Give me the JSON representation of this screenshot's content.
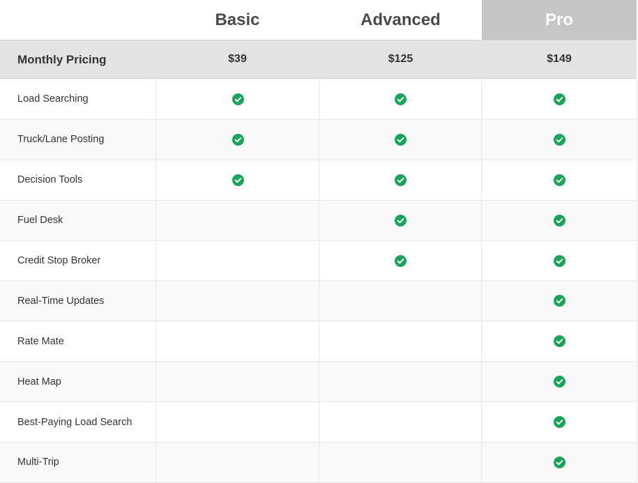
{
  "tiers": [
    "Basic",
    "Advanced",
    "Pro"
  ],
  "pricing": {
    "label": "Monthly Pricing",
    "prices": [
      "$39",
      "$125",
      "$149"
    ]
  },
  "features": [
    {
      "name": "Load Searching",
      "included": [
        true,
        true,
        true
      ]
    },
    {
      "name": "Truck/Lane Posting",
      "included": [
        true,
        true,
        true
      ]
    },
    {
      "name": "Decision Tools",
      "included": [
        true,
        true,
        true
      ]
    },
    {
      "name": "Fuel Desk",
      "included": [
        false,
        true,
        true
      ]
    },
    {
      "name": "Credit Stop Broker",
      "included": [
        false,
        true,
        true
      ]
    },
    {
      "name": "Real-Time Updates",
      "included": [
        false,
        false,
        true
      ]
    },
    {
      "name": "Rate Mate",
      "included": [
        false,
        false,
        true
      ]
    },
    {
      "name": "Heat Map",
      "included": [
        false,
        false,
        true
      ]
    },
    {
      "name": "Best-Paying Load Search",
      "included": [
        false,
        false,
        true
      ]
    },
    {
      "name": "Multi-Trip",
      "included": [
        false,
        false,
        true
      ]
    }
  ],
  "colors": {
    "check": "#1aa35a",
    "pro_header": "#c6c6c6",
    "pricing_row": "#e3e3e3"
  },
  "icons": {
    "included": "check-circle-icon"
  }
}
